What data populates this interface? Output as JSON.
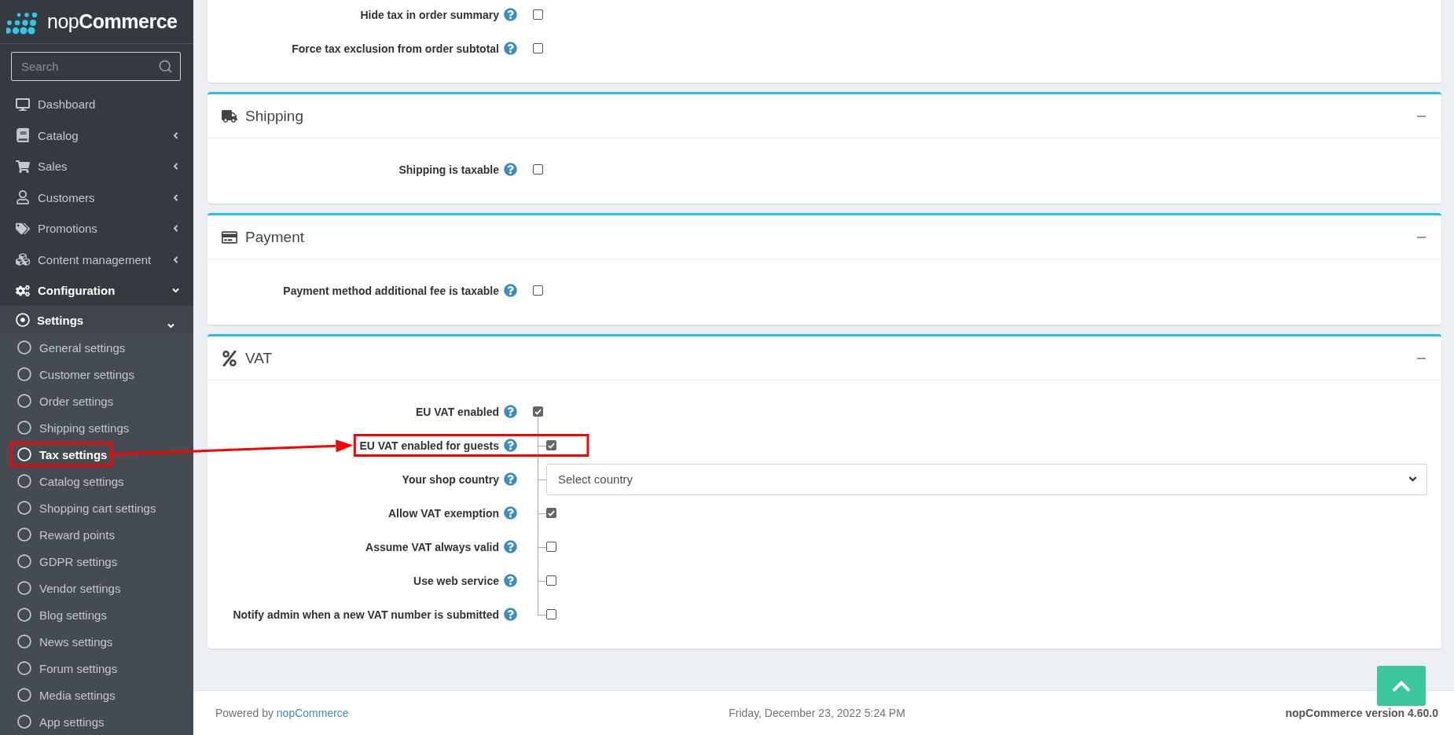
{
  "sidebar": {
    "logo": {
      "light": "nop",
      "bold": "Commerce"
    },
    "search": {
      "placeholder": "Search"
    },
    "menu": [
      {
        "label": "Dashboard",
        "kind": "link"
      },
      {
        "label": "Catalog",
        "kind": "group",
        "expanded": false
      },
      {
        "label": "Sales",
        "kind": "group",
        "expanded": false
      },
      {
        "label": "Customers",
        "kind": "group",
        "expanded": false
      },
      {
        "label": "Promotions",
        "kind": "group",
        "expanded": false
      },
      {
        "label": "Content management",
        "kind": "group",
        "expanded": false
      },
      {
        "label": "Configuration",
        "kind": "group",
        "expanded": true,
        "children": [
          {
            "label": "Settings",
            "expanded": true,
            "children": [
              {
                "label": "General settings",
                "selected": false,
                "annotated": false
              },
              {
                "label": "Customer settings",
                "selected": false,
                "annotated": false
              },
              {
                "label": "Order settings",
                "selected": false,
                "annotated": false
              },
              {
                "label": "Shipping settings",
                "selected": false,
                "annotated": false
              },
              {
                "label": "Tax settings",
                "selected": true,
                "annotated": true
              },
              {
                "label": "Catalog settings",
                "selected": false,
                "annotated": false
              },
              {
                "label": "Shopping cart settings",
                "selected": false,
                "annotated": false
              },
              {
                "label": "Reward points",
                "selected": false,
                "annotated": false
              },
              {
                "label": "GDPR settings",
                "selected": false,
                "annotated": false
              },
              {
                "label": "Vendor settings",
                "selected": false,
                "annotated": false
              },
              {
                "label": "Blog settings",
                "selected": false,
                "annotated": false
              },
              {
                "label": "News settings",
                "selected": false,
                "annotated": false
              },
              {
                "label": "Forum settings",
                "selected": false,
                "annotated": false
              },
              {
                "label": "Media settings",
                "selected": false,
                "annotated": false
              },
              {
                "label": "App settings",
                "selected": false,
                "annotated": false
              }
            ]
          }
        ]
      }
    ]
  },
  "sections": [
    {
      "rows": [
        {
          "label": "Hide tax in order summary",
          "kind": "checkbox",
          "checked": false,
          "nested": false,
          "annotated": false
        },
        {
          "label": "Force tax exclusion from order subtotal",
          "kind": "checkbox",
          "checked": false,
          "nested": false,
          "annotated": false
        }
      ]
    },
    {
      "title": "Shipping",
      "rows": [
        {
          "label": "Shipping is taxable",
          "kind": "checkbox",
          "checked": false,
          "nested": false,
          "annotated": false
        }
      ]
    },
    {
      "title": "Payment",
      "rows": [
        {
          "label": "Payment method additional fee is taxable",
          "kind": "checkbox",
          "checked": false,
          "nested": false,
          "annotated": false
        }
      ]
    },
    {
      "title": "VAT",
      "rows": [
        {
          "label": "EU VAT enabled",
          "kind": "checkbox",
          "checked": true,
          "nested": false,
          "annotated": false
        },
        {
          "label": "EU VAT enabled for guests",
          "kind": "checkbox",
          "checked": true,
          "nested": true,
          "annotated": true
        },
        {
          "label": "Your shop country",
          "kind": "select",
          "value": "Select country",
          "nested": true,
          "annotated": false
        },
        {
          "label": "Allow VAT exemption",
          "kind": "checkbox",
          "checked": true,
          "nested": true,
          "annotated": false
        },
        {
          "label": "Assume VAT always valid",
          "kind": "checkbox",
          "checked": false,
          "nested": true,
          "annotated": false
        },
        {
          "label": "Use web service",
          "kind": "checkbox",
          "checked": false,
          "nested": true,
          "annotated": false
        },
        {
          "label": "Notify admin when a new VAT number is submitted",
          "kind": "checkbox",
          "checked": false,
          "nested": true,
          "annotated": false
        }
      ]
    }
  ],
  "footer": {
    "powered_by": "Powered by",
    "link": "nopCommerce",
    "date": "Friday, December 23, 2022 5:24 PM",
    "version": "nopCommerce version 4.60.0"
  }
}
